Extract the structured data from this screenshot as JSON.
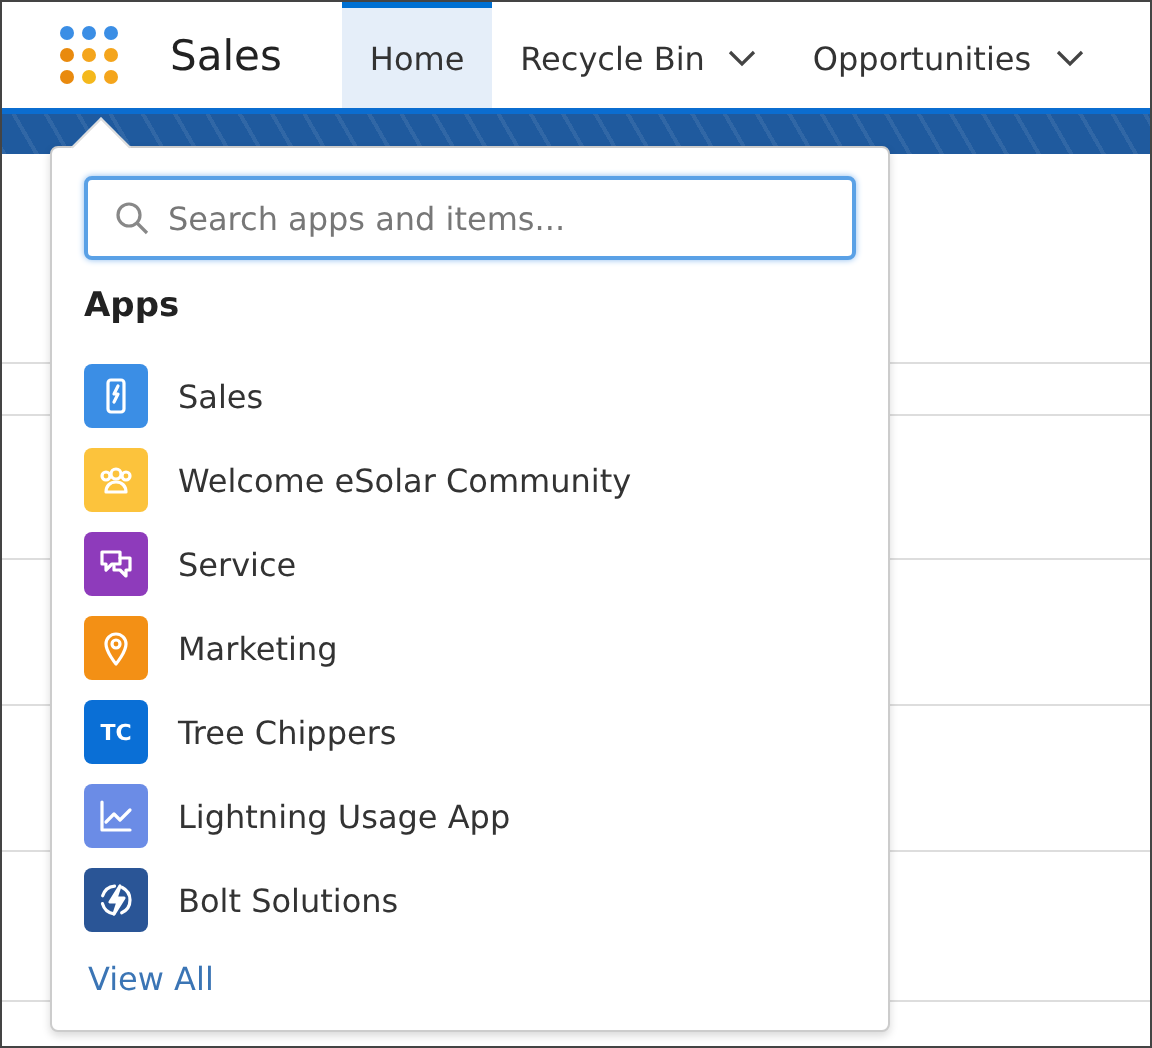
{
  "app_name": "Sales",
  "tabs": [
    {
      "label": "Home",
      "selected": true,
      "menu": false
    },
    {
      "label": "Recycle Bin",
      "selected": false,
      "menu": true
    },
    {
      "label": "Opportunities",
      "selected": false,
      "menu": true
    }
  ],
  "launcher_panel": {
    "search": {
      "placeholder": "Search apps and items..."
    },
    "heading": "Apps",
    "apps": [
      {
        "name": "Sales",
        "kind": "phone",
        "color": "#3b8ee5"
      },
      {
        "name": "Welcome eSolar Community",
        "kind": "people",
        "color": "#fcc33c"
      },
      {
        "name": "Service",
        "kind": "chat",
        "color": "#8e3bbb"
      },
      {
        "name": "Marketing",
        "kind": "pin",
        "color": "#f39015"
      },
      {
        "name": "Tree Chippers",
        "kind": "initials",
        "initials": "TC",
        "color": "#0a6fd6"
      },
      {
        "name": "Lightning Usage App",
        "kind": "chart",
        "color": "#6b8ce6"
      },
      {
        "name": "Bolt Solutions",
        "kind": "bolt",
        "color": "#2a5596"
      }
    ],
    "view_all": "View All"
  }
}
